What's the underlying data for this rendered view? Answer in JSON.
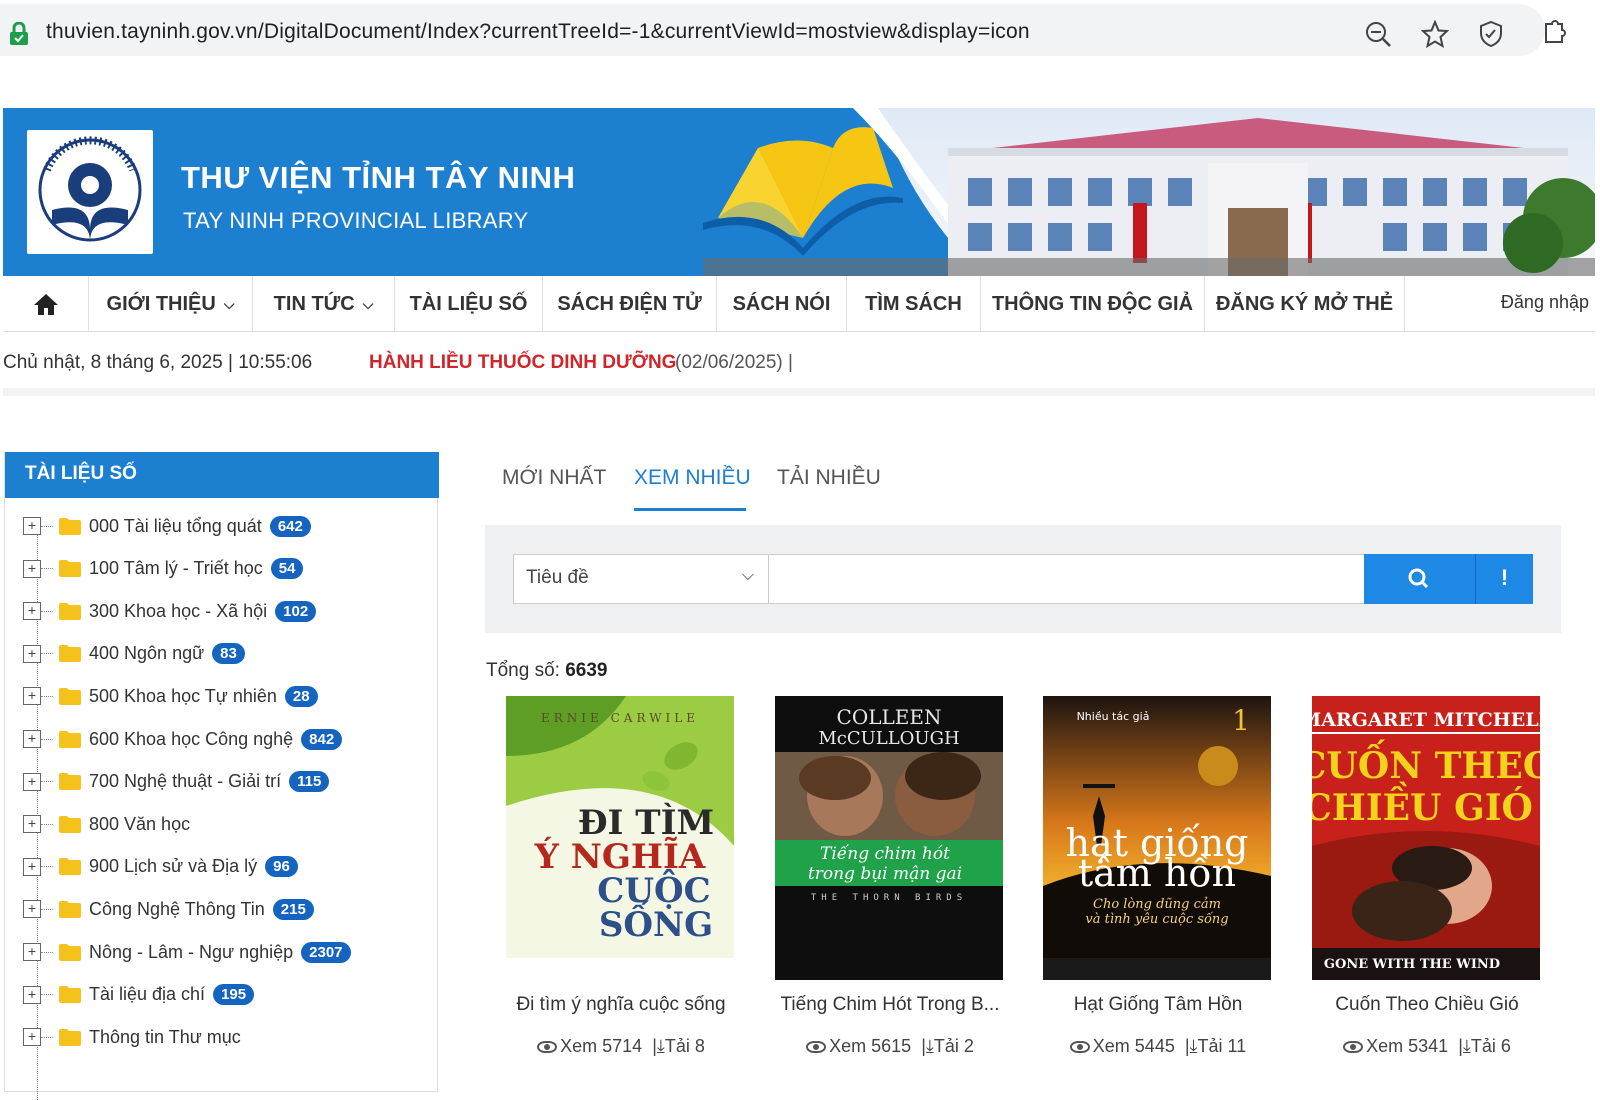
{
  "browser": {
    "url": "thuvien.tayninh.gov.vn/DigitalDocument/Index?currentTreeId=-1&currentViewId=mostview&display=icon"
  },
  "banner": {
    "title": "THƯ VIỆN TỈNH TÂY NINH",
    "subtitle": "TAY NINH PROVINCIAL LIBRARY"
  },
  "nav": {
    "items": [
      {
        "label": "GIỚI THIỆU"
      },
      {
        "label": "TIN TỨC"
      },
      {
        "label": "TÀI LIỆU SỐ"
      },
      {
        "label": "SÁCH ĐIỆN TỬ"
      },
      {
        "label": "SÁCH NÓI"
      },
      {
        "label": "TÌM SÁCH"
      },
      {
        "label": "THÔNG TIN ĐỘC GIẢ"
      },
      {
        "label": "ĐĂNG KÝ MỞ THẺ"
      }
    ],
    "login": "Đăng nhập"
  },
  "ticker": {
    "datetime": "Chủ nhật, 8 tháng 6, 2025 | 10:55:06",
    "news": "HÀNH LIỀU THUỐC DINH DƯỠNG",
    "news_date": "(02/06/2025) |"
  },
  "sidebar": {
    "title": "TÀI LIỆU SỐ",
    "items": [
      {
        "label": "000 Tài liệu tổng quát",
        "count": "642"
      },
      {
        "label": "100 Tâm lý - Triết học",
        "count": "54"
      },
      {
        "label": "300 Khoa học - Xã hội",
        "count": "102"
      },
      {
        "label": "400 Ngôn ngữ",
        "count": "83"
      },
      {
        "label": "500 Khoa học Tự nhiên",
        "count": "28"
      },
      {
        "label": "600 Khoa học Công nghệ",
        "count": "842"
      },
      {
        "label": "700 Nghệ thuật - Giải trí",
        "count": "115"
      },
      {
        "label": "800 Văn học",
        "count": ""
      },
      {
        "label": "900 Lịch sử và Địa lý",
        "count": "96"
      },
      {
        "label": "Công Nghệ Thông Tin",
        "count": "215"
      },
      {
        "label": "Nông - Lâm - Ngư nghiệp",
        "count": "2307"
      },
      {
        "label": "Tài liệu địa chí",
        "count": "195"
      },
      {
        "label": "Thông tin Thư mục",
        "count": ""
      }
    ]
  },
  "tabs": [
    {
      "label": "MỚI NHẤT",
      "active": false
    },
    {
      "label": "XEM NHIỀU",
      "active": true
    },
    {
      "label": "TẢI NHIỀU",
      "active": false
    }
  ],
  "search": {
    "field_selected": "Tiêu đề",
    "query": "",
    "info_label": "!"
  },
  "total": {
    "label": "Tổng số:",
    "value": "6639"
  },
  "books": [
    {
      "title": "Đi tìm ý nghĩa cuộc sống",
      "views_label": "Xem",
      "views": "5714",
      "downloads_label": "Tải",
      "downloads": "8",
      "cover_author": "ERNIE CARWILE",
      "cover_title_1": "ĐI TÌM",
      "cover_title_2": "Ý NGHĨA",
      "cover_title_3": "CUỘC",
      "cover_title_4": "SỐNG"
    },
    {
      "title": "Tiếng Chim Hót Trong B...",
      "views_label": "Xem",
      "views": "5615",
      "downloads_label": "Tải",
      "downloads": "2",
      "cover_author_1": "COLLEEN",
      "cover_author_2": "McCULLOUGH",
      "cover_title_1": "Tiếng chim hót",
      "cover_title_2": "trong bụi mận gai",
      "cover_sub": "THE THORN BIRDS"
    },
    {
      "title": "Hạt Giống Tâm Hồn",
      "views_label": "Xem",
      "views": "5445",
      "downloads_label": "Tải",
      "downloads": "11",
      "cover_top": "Nhiều tác giả",
      "cover_num": "1",
      "cover_title_1": "hạt giống",
      "cover_title_2": "tâm hồn",
      "cover_sub_1": "Cho lòng dũng cảm",
      "cover_sub_2": "và tình yêu cuộc sống"
    },
    {
      "title": "Cuốn Theo Chiều Gió",
      "views_label": "Xem",
      "views": "5341",
      "downloads_label": "Tải",
      "downloads": "6",
      "cover_author": "MARGARET MITCHELL",
      "cover_title_1": "CUỐN THEO",
      "cover_title_2": "CHIỀU GIÓ",
      "cover_sub": "GONE WITH THE WIND"
    }
  ]
}
